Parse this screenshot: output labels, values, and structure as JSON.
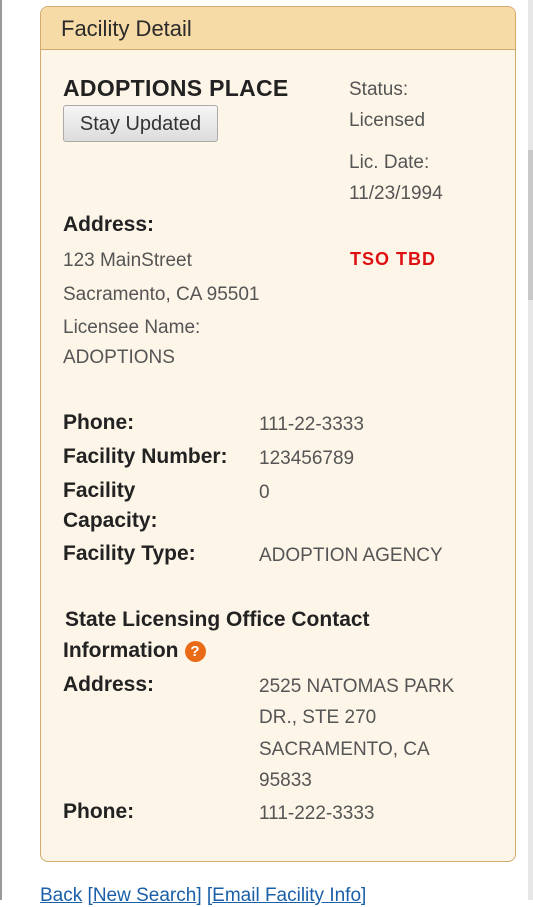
{
  "panel": {
    "title": "Facility Detail",
    "facility_name": "ADOPTIONS PLACE",
    "stay_updated_label": "Stay Updated",
    "status_label": "Status:",
    "status_value": "Licensed",
    "lic_date_label": "Lic. Date:",
    "lic_date_value": "11/23/1994",
    "tso": "TSO TBD",
    "address_label": "Address:",
    "address_line1": "123 MainStreet",
    "address_line2": "Sacramento, CA 95501",
    "licensee_label": "Licensee Name:",
    "licensee_value": "ADOPTIONS",
    "phone_label": "Phone:",
    "phone_value": "111-22-3333",
    "facility_number_label": "Facility Number:",
    "facility_number_value": "123456789",
    "capacity_label_line1": "Facility",
    "capacity_label_line2": "Capacity:",
    "capacity_value": "0",
    "facility_type_label": "Facility Type:",
    "facility_type_value": "ADOPTION AGENCY",
    "slo_heading_line1": "State Licensing Office Contact",
    "slo_heading_line2": "Information",
    "slo_help_icon": "?",
    "slo_address_label": "Address:",
    "slo_address_line1": "2525 NATOMAS PARK",
    "slo_address_line2": "DR., STE 270",
    "slo_address_line3": "SACRAMENTO, CA",
    "slo_address_line4": "95833",
    "slo_phone_label": "Phone:",
    "slo_phone_value": "111-222-3333"
  },
  "footer": {
    "back": "Back",
    "new_search": "New Search",
    "email_info": "Email Facility Info"
  },
  "colors": {
    "panel_bg": "#fcf5e8",
    "header_bg": "#f7dba6",
    "border": "#d2aa6e",
    "tso_red": "#dd1111",
    "help_orange": "#ea6b17",
    "link_blue": "#1a5fa8"
  }
}
